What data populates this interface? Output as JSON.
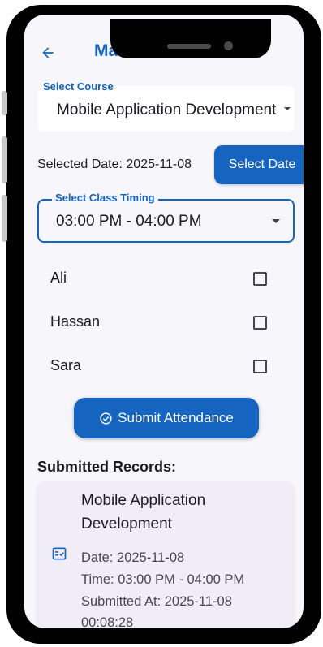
{
  "header": {
    "title": "Mark Attendance"
  },
  "course": {
    "label": "Select Course",
    "value": "Mobile Application Development"
  },
  "date": {
    "selected_text": "Selected Date: 2025-11-08",
    "button_label": "Select Date"
  },
  "timing": {
    "label": "Select Class Timing",
    "value": "03:00 PM - 04:00 PM"
  },
  "students": [
    {
      "name": "Ali",
      "checked": false
    },
    {
      "name": "Hassan",
      "checked": false
    },
    {
      "name": "Sara",
      "checked": false
    }
  ],
  "submit": {
    "label": "Submit Attendance",
    "icon": "check-circle-icon"
  },
  "records": {
    "heading": "Submitted Records:",
    "items": [
      {
        "course": "Mobile Application Development",
        "date": "Date: 2025-11-08",
        "time": "Time: 03:00 PM - 04:00 PM",
        "submitted_at_1": "Submitted At: 2025-11-08",
        "submitted_at_2": "00:08:28",
        "icon": "checklist-icon"
      }
    ]
  },
  "colors": {
    "primary": "#1565c0",
    "background": "#f7f6fa",
    "card": "#f0edf6",
    "text": "#1d1b20"
  }
}
